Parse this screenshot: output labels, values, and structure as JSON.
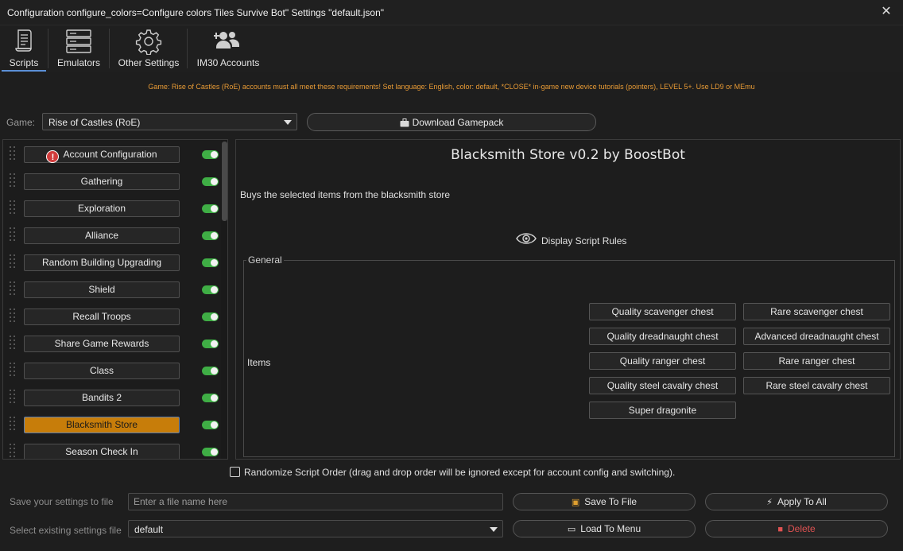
{
  "window": {
    "title": "Configuration configure_colors=Configure colors Tiles Survive Bot\" Settings \"default.json\""
  },
  "nav": {
    "tabs": [
      {
        "label": "Scripts",
        "icon": "scroll-icon",
        "active": true
      },
      {
        "label": "Emulators",
        "icon": "server-stack-icon",
        "active": false
      },
      {
        "label": "Other Settings",
        "icon": "gear-icon",
        "active": false
      },
      {
        "label": "IM30 Accounts",
        "icon": "users-plus-icon",
        "active": false
      }
    ]
  },
  "notice": "Game: Rise of Castles (RoE) accounts must all meet these requirements! Set language: English, color: default, *CLOSE* in-game new device tutorials (pointers), LEVEL 5+. Use LD9 or MEmu",
  "game": {
    "label": "Game:",
    "selected": "Rise of Castles (RoE)",
    "download_label": "Download Gamepack"
  },
  "scripts": [
    {
      "label": "Account Configuration",
      "enabled": true,
      "warning": true,
      "selected": false
    },
    {
      "label": "Gathering",
      "enabled": true,
      "warning": false,
      "selected": false
    },
    {
      "label": "Exploration",
      "enabled": true,
      "warning": false,
      "selected": false
    },
    {
      "label": "Alliance",
      "enabled": true,
      "warning": false,
      "selected": false
    },
    {
      "label": "Random Building Upgrading",
      "enabled": true,
      "warning": false,
      "selected": false
    },
    {
      "label": "Shield",
      "enabled": true,
      "warning": false,
      "selected": false
    },
    {
      "label": "Recall Troops",
      "enabled": true,
      "warning": false,
      "selected": false
    },
    {
      "label": "Share Game Rewards",
      "enabled": true,
      "warning": false,
      "selected": false
    },
    {
      "label": "Class",
      "enabled": true,
      "warning": false,
      "selected": false
    },
    {
      "label": "Bandits 2",
      "enabled": true,
      "warning": false,
      "selected": false
    },
    {
      "label": "Blacksmith Store",
      "enabled": true,
      "warning": false,
      "selected": true
    },
    {
      "label": "Season Check In",
      "enabled": true,
      "warning": false,
      "selected": false
    }
  ],
  "detail": {
    "title": "Blacksmith Store v0.2 by BoostBot",
    "description": "Buys the selected items from the blacksmith store",
    "rules_label": "Display Script Rules",
    "group_label": "General",
    "items_label": "Items",
    "items": [
      "Quality scavenger chest",
      "Rare scavenger chest",
      "Quality dreadnaught chest",
      "Advanced dreadnaught chest",
      "Quality ranger chest",
      "Rare ranger chest",
      "Quality steel cavalry chest",
      "Rare steel cavalry chest",
      "Super dragonite"
    ]
  },
  "randomize_label": "Randomize Script Order (drag and drop order will be ignored except for account config and switching).",
  "footer": {
    "save_label": "Save your settings to file",
    "save_placeholder": "Enter a file name here",
    "select_label": "Select existing settings file",
    "select_value": "default",
    "save_btn": "Save To File",
    "apply_btn": "Apply To All",
    "load_btn": "Load To Menu",
    "delete_btn": "Delete"
  },
  "colors": {
    "accent": "#c77d0a",
    "toggle_on": "#3fae45",
    "notice": "#e79a35",
    "danger": "#e05252"
  }
}
